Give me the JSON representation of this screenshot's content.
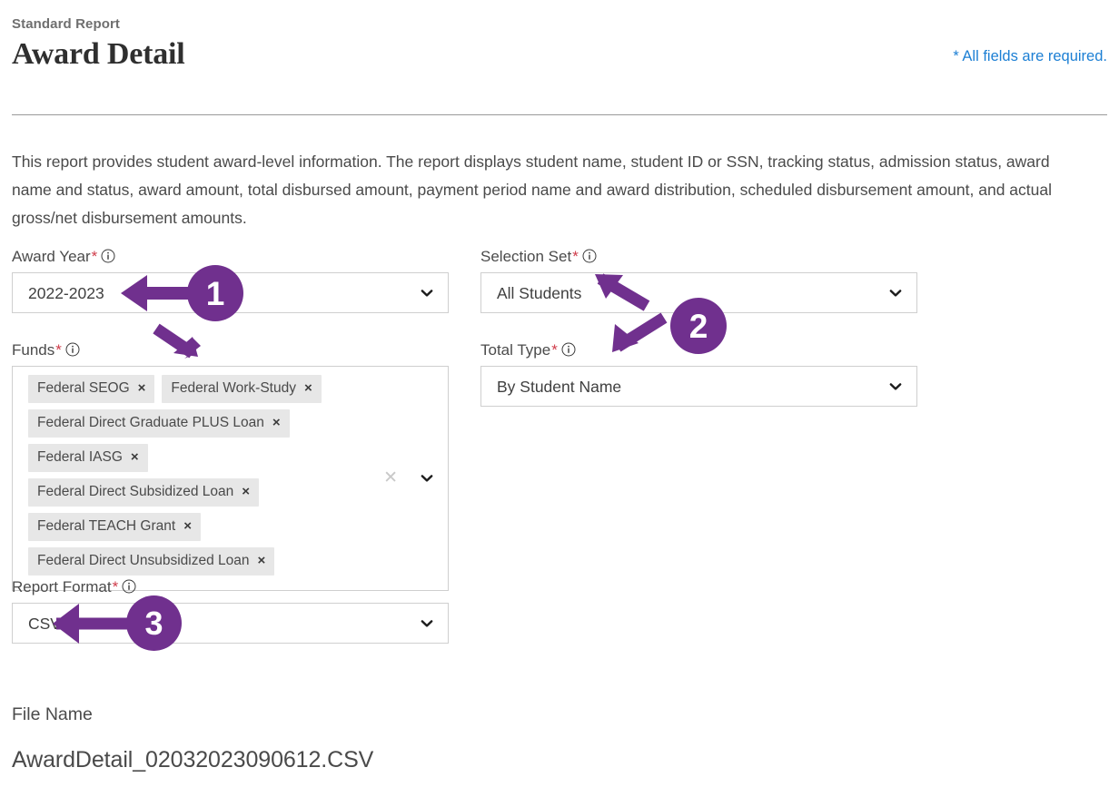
{
  "header": {
    "eyebrow": "Standard Report",
    "title": "Award Detail",
    "required_note": "* All fields are required."
  },
  "description": "This report provides student award-level information. The report displays student name, student ID or SSN, tracking status, admission status, award name and status, award amount, total disbursed amount, payment period name and award distribution, scheduled disbursement amount, and actual gross/net disbursement amounts.",
  "form": {
    "required_marker": "*",
    "info_icon": "info-icon",
    "chevron_icon": "chevron-down-icon",
    "clear_icon": "clear-x-icon",
    "chip_remove_icon": "×",
    "fields": {
      "award_year": {
        "label": "Award Year",
        "value": "2022-2023"
      },
      "selection_set": {
        "label": "Selection Set",
        "value": "All Students"
      },
      "funds": {
        "label": "Funds",
        "chips": [
          "Federal SEOG",
          "Federal Work-Study",
          "Federal Direct Graduate PLUS Loan",
          "Federal IASG",
          "Federal Direct Subsidized Loan",
          "Federal TEACH Grant",
          "Federal Direct Unsubsidized Loan"
        ]
      },
      "total_type": {
        "label": "Total Type",
        "value": "By Student Name"
      },
      "report_format": {
        "label": "Report Format",
        "value": "CSV"
      }
    }
  },
  "file_name": {
    "label": "File Name",
    "value": "AwardDetail_02032023090612.CSV"
  },
  "annotations": {
    "accent_color": "#70308E",
    "badges": [
      {
        "number": "1",
        "points_to": "award-year-select"
      },
      {
        "number": "2",
        "points_to": "selection-set-select and total-type-select"
      },
      {
        "number": "3",
        "points_to": "report-format-select"
      }
    ]
  },
  "colors": {
    "link_blue": "#1C7FD4",
    "required_red": "#CF3B4A",
    "chip_gray": "#E7E7E7",
    "border_gray": "#CFCFCF",
    "annotation_purple": "#70308E"
  }
}
